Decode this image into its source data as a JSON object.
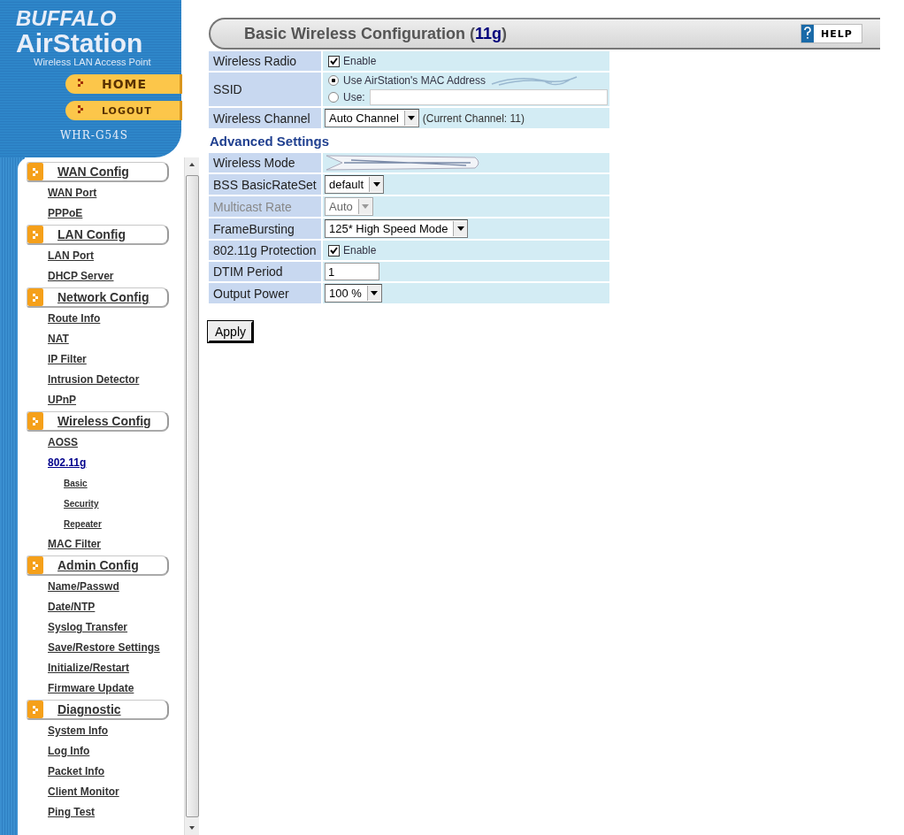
{
  "brand": {
    "maker": "BUFFALO",
    "product": "AirStation",
    "tagline": "Wireless LAN Access Point",
    "model": "WHR-G54S",
    "buttons": [
      {
        "label": "HOME"
      },
      {
        "label": "LOGOUT"
      }
    ]
  },
  "nav": {
    "sections": [
      {
        "title": "WAN Config",
        "items": [
          {
            "label": "WAN Port",
            "selected": false
          },
          {
            "label": "PPPoE",
            "selected": false
          }
        ]
      },
      {
        "title": "LAN Config",
        "items": [
          {
            "label": "LAN Port",
            "selected": false
          },
          {
            "label": "DHCP Server",
            "selected": false
          }
        ]
      },
      {
        "title": "Network Config",
        "items": [
          {
            "label": "Route Info",
            "selected": false
          },
          {
            "label": "NAT",
            "selected": false
          },
          {
            "label": "IP Filter",
            "selected": false
          },
          {
            "label": "Intrusion Detector",
            "selected": false
          },
          {
            "label": "UPnP",
            "selected": false
          }
        ]
      },
      {
        "title": "Wireless Config",
        "items": [
          {
            "label": "AOSS",
            "selected": false
          },
          {
            "label": "802.11g",
            "selected": true,
            "children": [
              {
                "label": "Basic",
                "selected": false
              },
              {
                "label": "Security",
                "selected": false
              },
              {
                "label": "Repeater",
                "selected": false
              }
            ]
          },
          {
            "label": "MAC Filter",
            "selected": false
          }
        ]
      },
      {
        "title": "Admin Config",
        "items": [
          {
            "label": "Name/Passwd",
            "selected": false
          },
          {
            "label": "Date/NTP",
            "selected": false
          },
          {
            "label": "Syslog Transfer",
            "selected": false
          },
          {
            "label": "Save/Restore Settings",
            "selected": false
          },
          {
            "label": "Initialize/Restart",
            "selected": false
          },
          {
            "label": "Firmware Update",
            "selected": false
          }
        ]
      },
      {
        "title": "Diagnostic",
        "items": [
          {
            "label": "System Info",
            "selected": false
          },
          {
            "label": "Log Info",
            "selected": false
          },
          {
            "label": "Packet Info",
            "selected": false
          },
          {
            "label": "Client Monitor",
            "selected": false
          },
          {
            "label": "Ping Test",
            "selected": false
          }
        ]
      }
    ]
  },
  "page": {
    "title": "Basic Wireless Configuration (",
    "title_highlight": "11g",
    "title_end": ")",
    "help": "HELP"
  },
  "basic_rows": [
    {
      "kind": "checkbox",
      "label": "Wireless Radio",
      "option": "Enable",
      "checked": true,
      "disabled": false
    },
    {
      "kind": "radio_group",
      "label": "SSID",
      "disabled": false,
      "options": [
        {
          "kind": "plain",
          "label": "Use AirStation's MAC Address",
          "selected": true
        },
        {
          "kind": "field",
          "label": "Use:",
          "selected": false
        }
      ]
    },
    {
      "kind": "select",
      "label": "Wireless Channel",
      "value": "Auto Channel",
      "note": "(Current Channel: 11)",
      "disabled": false
    }
  ],
  "advanced_title": "Advanced Settings",
  "advanced_rows": [
    {
      "kind": "redacted",
      "label": "Wireless Mode",
      "disabled": false
    },
    {
      "kind": "select",
      "label": "BSS BasicRateSet",
      "value": "default",
      "disabled": false
    },
    {
      "kind": "select",
      "label": "Multicast Rate",
      "value": "Auto",
      "disabled": true
    },
    {
      "kind": "select",
      "label": "FrameBursting",
      "value": "125* High Speed Mode",
      "disabled": false
    },
    {
      "kind": "checkbox",
      "label": "802.11g Protection",
      "option": "Enable",
      "checked": true,
      "disabled": false
    },
    {
      "kind": "text",
      "label": "DTIM Period",
      "value": "1",
      "disabled": false
    },
    {
      "kind": "select",
      "label": "Output Power",
      "value": "100 %",
      "disabled": false
    }
  ],
  "apply": "Apply"
}
